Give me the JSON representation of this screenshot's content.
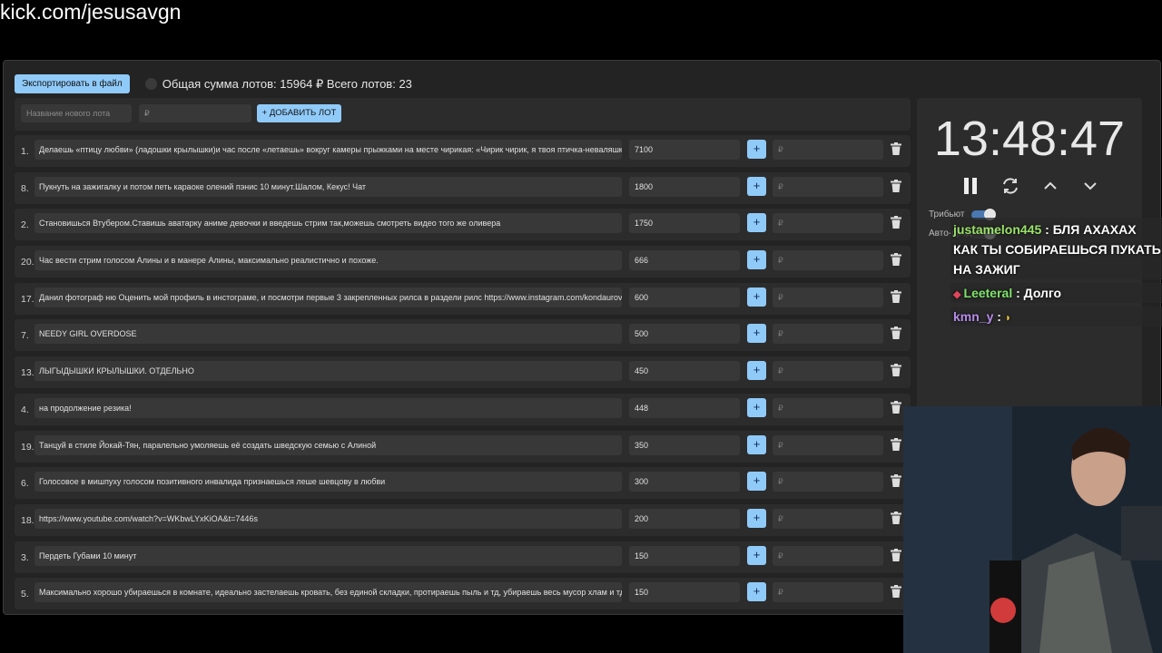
{
  "url_bar": "kick.com/jesusavgn",
  "toolbar": {
    "export_label": "Экспортировать в файл",
    "summary": "Общая сумма лотов: 15964 ₽ Всего лотов: 23"
  },
  "add_row": {
    "name_placeholder": "Название нового лота",
    "price_placeholder": "₽",
    "add_label": "+ ДОБАВИТЬ ЛОТ"
  },
  "lots": [
    {
      "num": "1.",
      "title": "Делаешь «птицу любви» (ладошки крылышки)и час после «летаешь» вокруг камеры прыжками на месте чирикая: «Чирик чирик, я твоя птичка-неваляшка",
      "amount": "7100",
      "add_placeholder": "₽"
    },
    {
      "num": "8.",
      "title": "Пукнуть на зажигалку и потом петь караоке олений пэнис 10 минут.Шалом, Кекус! Чат",
      "amount": "1800",
      "add_placeholder": "₽"
    },
    {
      "num": "2.",
      "title": "Становишься Втубером.Ставишь аватарку аниме девочки и введешь стрим так,можешь смотреть видео того же оливера",
      "amount": "1750",
      "add_placeholder": "₽"
    },
    {
      "num": "20.",
      "title": "Час вести стрим голосом Алины и в манере Алины, максимально реалистично и похоже.",
      "amount": "666",
      "add_placeholder": "₽"
    },
    {
      "num": "17.",
      "title": "Данил фотограф ню Оценить мой профиль в инстограме, и посмотри первые 3 закрепленных рилса в раздели рилс https://www.instagram.com/kondaurov",
      "amount": "600",
      "add_placeholder": "₽"
    },
    {
      "num": "7.",
      "title": "NEEDY GIRL OVERDOSE",
      "amount": "500",
      "add_placeholder": "₽"
    },
    {
      "num": "13.",
      "title": "ЛЫГЫДЫШКИ КРЫЛЫШКИ. ОТДЕЛЬНО",
      "amount": "450",
      "add_placeholder": "₽"
    },
    {
      "num": "4.",
      "title": "на продолжение резика!",
      "amount": "448",
      "add_placeholder": "₽"
    },
    {
      "num": "19.",
      "title": "Танцуй в стиле Йокай-Тян, паралельно умоляешь её создать шведскую семью с Алиной",
      "amount": "350",
      "add_placeholder": "₽"
    },
    {
      "num": "6.",
      "title": "Голосовое в мишпуху голосом позитивного инвалида признаешься леше шевцову в любви",
      "amount": "300",
      "add_placeholder": "₽"
    },
    {
      "num": "18.",
      "title": "https://www.youtube.com/watch?v=WKbwLYxKiOA&t=7446s",
      "amount": "200",
      "add_placeholder": "₽"
    },
    {
      "num": "3.",
      "title": "Пердеть Губами 10 минут",
      "amount": "150",
      "add_placeholder": "₽"
    },
    {
      "num": "5.",
      "title": "Максимально хорошо убираешься в комнате, идеально застелаешь кровать, без единой складки, протираешь пыль и тд, убираешь весь мусор хлам и тд",
      "amount": "150",
      "add_placeholder": "₽"
    }
  ],
  "timer": {
    "time": "13:48:47",
    "tribute_label": "Трибьют",
    "auto_label": "Авто-продление"
  },
  "chat": [
    {
      "user": "justamelon445",
      "sep": " : ",
      "text": "БЛЯ АХАХАХ",
      "line2": "КАК ТЫ СОБИРАЕШЬСЯ ПУКАТЬ",
      "line3": "НА ЗАЖИГ",
      "color": "#9be36b"
    },
    {
      "user": "Leeteral",
      "sep": " : ",
      "text": "Долго",
      "color": "#7ee36b"
    },
    {
      "user": "kmn_y",
      "sep": " : ",
      "text": "",
      "color": "#b58be8"
    }
  ],
  "colors": {
    "accent": "#90caf9",
    "panel": "#2c2c2c",
    "field": "#383838"
  }
}
